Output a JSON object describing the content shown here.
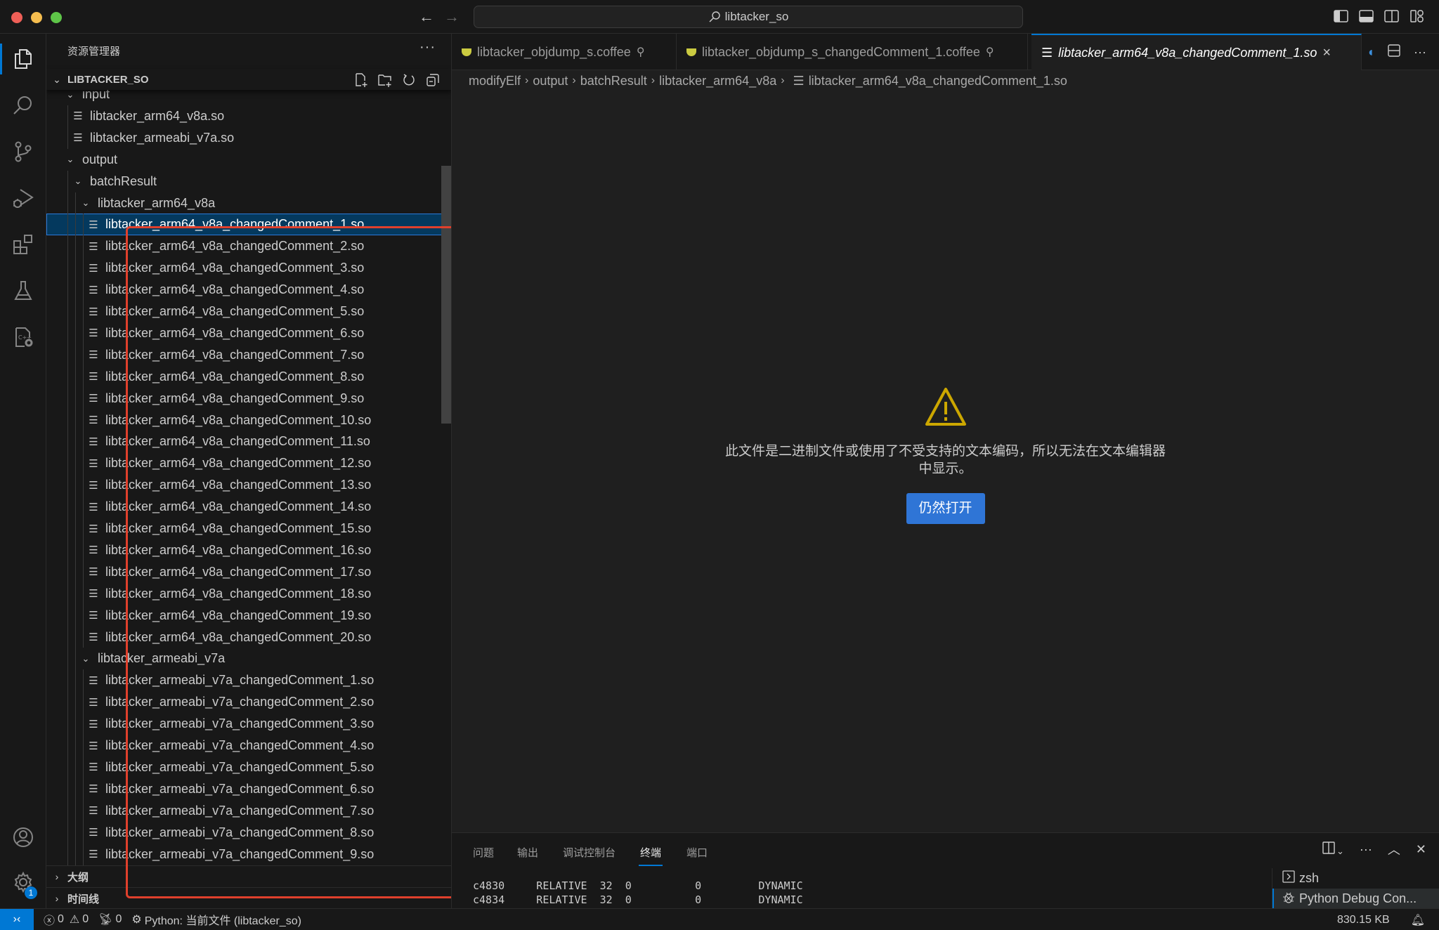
{
  "window": {
    "command_center": "libtacker_so"
  },
  "activity_bar": {
    "items": [
      {
        "name": "explorer",
        "active": true
      },
      {
        "name": "search"
      },
      {
        "name": "source-control"
      },
      {
        "name": "run-and-debug"
      },
      {
        "name": "extensions"
      },
      {
        "name": "testing"
      },
      {
        "name": "cpp-config"
      }
    ],
    "bottom": [
      {
        "name": "accounts"
      },
      {
        "name": "manage",
        "badge": "1"
      }
    ]
  },
  "sidebar": {
    "title": "资源管理器",
    "more": "···",
    "section": "LIBTACKER_SO",
    "tree": [
      {
        "label": "input",
        "type": "folder",
        "depth": 1,
        "expanded": true
      },
      {
        "label": "libtacker_arm64_v8a.so",
        "type": "file",
        "depth": 2
      },
      {
        "label": "libtacker_armeabi_v7a.so",
        "type": "file",
        "depth": 2
      },
      {
        "label": "output",
        "type": "folder",
        "depth": 1,
        "expanded": true
      },
      {
        "label": "batchResult",
        "type": "folder",
        "depth": 2,
        "expanded": true
      },
      {
        "label": "libtacker_arm64_v8a",
        "type": "folder",
        "depth": 3,
        "expanded": true
      },
      {
        "label": "libtacker_arm64_v8a_changedComment_1.so",
        "type": "file",
        "depth": 4,
        "selected": true
      },
      {
        "label": "libtacker_arm64_v8a_changedComment_2.so",
        "type": "file",
        "depth": 4
      },
      {
        "label": "libtacker_arm64_v8a_changedComment_3.so",
        "type": "file",
        "depth": 4
      },
      {
        "label": "libtacker_arm64_v8a_changedComment_4.so",
        "type": "file",
        "depth": 4
      },
      {
        "label": "libtacker_arm64_v8a_changedComment_5.so",
        "type": "file",
        "depth": 4
      },
      {
        "label": "libtacker_arm64_v8a_changedComment_6.so",
        "type": "file",
        "depth": 4
      },
      {
        "label": "libtacker_arm64_v8a_changedComment_7.so",
        "type": "file",
        "depth": 4
      },
      {
        "label": "libtacker_arm64_v8a_changedComment_8.so",
        "type": "file",
        "depth": 4
      },
      {
        "label": "libtacker_arm64_v8a_changedComment_9.so",
        "type": "file",
        "depth": 4
      },
      {
        "label": "libtacker_arm64_v8a_changedComment_10.so",
        "type": "file",
        "depth": 4
      },
      {
        "label": "libtacker_arm64_v8a_changedComment_11.so",
        "type": "file",
        "depth": 4
      },
      {
        "label": "libtacker_arm64_v8a_changedComment_12.so",
        "type": "file",
        "depth": 4
      },
      {
        "label": "libtacker_arm64_v8a_changedComment_13.so",
        "type": "file",
        "depth": 4
      },
      {
        "label": "libtacker_arm64_v8a_changedComment_14.so",
        "type": "file",
        "depth": 4
      },
      {
        "label": "libtacker_arm64_v8a_changedComment_15.so",
        "type": "file",
        "depth": 4
      },
      {
        "label": "libtacker_arm64_v8a_changedComment_16.so",
        "type": "file",
        "depth": 4
      },
      {
        "label": "libtacker_arm64_v8a_changedComment_17.so",
        "type": "file",
        "depth": 4
      },
      {
        "label": "libtacker_arm64_v8a_changedComment_18.so",
        "type": "file",
        "depth": 4
      },
      {
        "label": "libtacker_arm64_v8a_changedComment_19.so",
        "type": "file",
        "depth": 4
      },
      {
        "label": "libtacker_arm64_v8a_changedComment_20.so",
        "type": "file",
        "depth": 4
      },
      {
        "label": "libtacker_armeabi_v7a",
        "type": "folder",
        "depth": 3,
        "expanded": true
      },
      {
        "label": "libtacker_armeabi_v7a_changedComment_1.so",
        "type": "file",
        "depth": 4
      },
      {
        "label": "libtacker_armeabi_v7a_changedComment_2.so",
        "type": "file",
        "depth": 4
      },
      {
        "label": "libtacker_armeabi_v7a_changedComment_3.so",
        "type": "file",
        "depth": 4
      },
      {
        "label": "libtacker_armeabi_v7a_changedComment_4.so",
        "type": "file",
        "depth": 4
      },
      {
        "label": "libtacker_armeabi_v7a_changedComment_5.so",
        "type": "file",
        "depth": 4
      },
      {
        "label": "libtacker_armeabi_v7a_changedComment_6.so",
        "type": "file",
        "depth": 4
      },
      {
        "label": "libtacker_armeabi_v7a_changedComment_7.so",
        "type": "file",
        "depth": 4
      },
      {
        "label": "libtacker_armeabi_v7a_changedComment_8.so",
        "type": "file",
        "depth": 4
      },
      {
        "label": "libtacker_armeabi_v7a_changedComment_9.so",
        "type": "file",
        "depth": 4
      }
    ],
    "outline_label": "大纲",
    "timeline_label": "时间线",
    "highlight_color": "#e0402c"
  },
  "tabs": [
    {
      "label": "libtacker_objdump_s.coffee",
      "icon": "coffee-icon",
      "pinned": true
    },
    {
      "label": "libtacker_objdump_s_changedComment_1.coffee",
      "icon": "coffee-icon",
      "pinned": true
    },
    {
      "label": "libtacker_arm64_v8a_changedComment_1.so",
      "icon": "file-text-icon",
      "active": true,
      "preview": true
    }
  ],
  "breadcrumb": [
    "modifyElf",
    "output",
    "batchResult",
    "libtacker_arm64_v8a",
    "libtacker_arm64_v8a_changedComment_1.so"
  ],
  "editor": {
    "warning_message": "此文件是二进制文件或使用了不受支持的文本编码，所以无法在文本编辑器中显示。",
    "open_anyway_label": "仍然打开",
    "warning_color": "#cca700",
    "button_color": "#2f75d6"
  },
  "panel": {
    "tabs": [
      "问题",
      "输出",
      "调试控制台",
      "终端",
      "端口"
    ],
    "active_tab": "终端",
    "terminal_lines": [
      "c4830     RELATIVE  32  0          0         DYNAMIC",
      "c4834     RELATIVE  32  0          0         DYNAMIC"
    ],
    "terminals": [
      {
        "label": "zsh",
        "icon": "terminal-icon"
      },
      {
        "label": "Python Debug Con...",
        "icon": "debug-icon",
        "active": true
      }
    ]
  },
  "statusbar": {
    "errors": "0",
    "warnings": "0",
    "ports": "0",
    "debug_config": "Python: 当前文件 (libtacker_so)",
    "file_size": "830.15 KB"
  }
}
